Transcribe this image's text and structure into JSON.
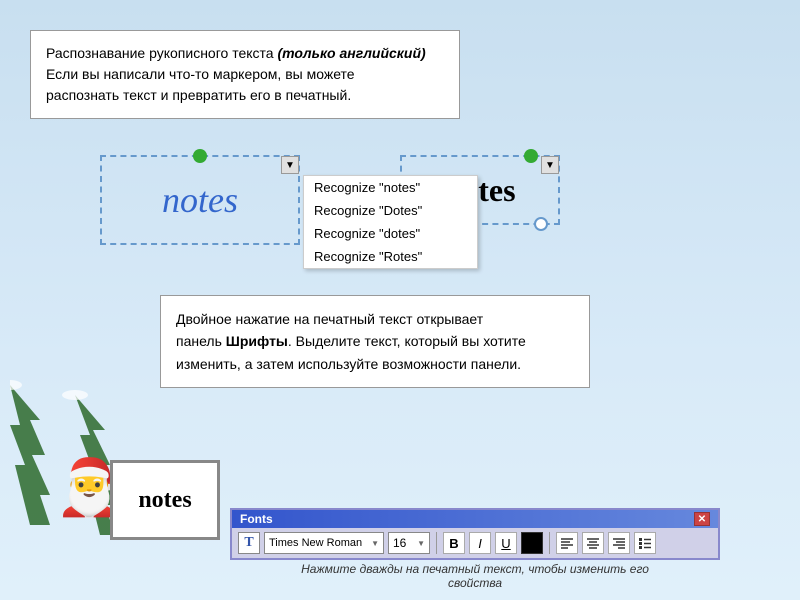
{
  "background": {
    "color_top": "#c8dff0",
    "color_bottom": "#e0f0fa"
  },
  "top_box": {
    "line1": "Распознавание рукописного текста ",
    "line1_italic": "(только английский)",
    "line2": "Если вы написали что-то маркером, вы можете",
    "line3": "распознать текст и превратить его в печатный."
  },
  "recognition": {
    "handwritten_text": "notes",
    "dropdown_arrow": "▼",
    "menu_items": [
      "Recognize \"notes\"",
      "Recognize \"Dotes\"",
      "Recognize \"dotes\"",
      "Recognize \"Rotes\""
    ],
    "printed_text": "notes"
  },
  "middle_box": {
    "line1": "Двойное нажатие на печатный текст открывает",
    "line2_start": "панель ",
    "line2_bold": "Шрифты",
    "line2_end": ". Выделите текст, который вы хотите",
    "line3": "изменить, а затем используйте возможности панели."
  },
  "notes_border": {
    "text": "notes"
  },
  "fonts_toolbar": {
    "title": "Fonts",
    "close_icon": "✕",
    "t_icon": "T",
    "font_name": "Times New Roman",
    "font_size": "16",
    "bold_label": "B",
    "italic_label": "I",
    "underline_label": "U",
    "dropdown_arrow": "▼"
  },
  "bottom_caption": {
    "line1": "Нажмите дважды на печатный текст, чтобы изменить его",
    "line2": "свойства"
  }
}
